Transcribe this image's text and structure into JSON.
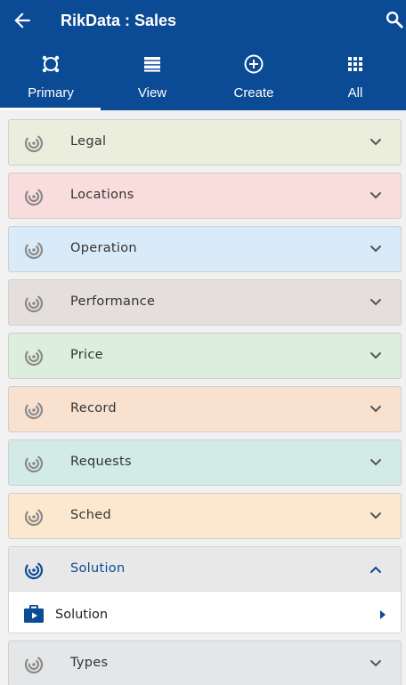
{
  "header": {
    "title": "RikData : Sales",
    "back_icon": "arrow-left-icon",
    "search_icon": "search-icon"
  },
  "tabs": [
    {
      "label": "Primary",
      "icon": "focus-frame-icon",
      "active": true
    },
    {
      "label": "View",
      "icon": "list-view-icon",
      "active": false
    },
    {
      "label": "Create",
      "icon": "add-circle-icon",
      "active": false
    },
    {
      "label": "All",
      "icon": "grid-apps-icon",
      "active": false
    }
  ],
  "sections": [
    {
      "label": "Legal",
      "color": "#ebeedc",
      "expanded": false
    },
    {
      "label": "Locations",
      "color": "#f9dcdc",
      "expanded": false
    },
    {
      "label": "Operation",
      "color": "#d9eaf8",
      "expanded": false
    },
    {
      "label": "Performance",
      "color": "#e4dfdc",
      "expanded": false
    },
    {
      "label": "Price",
      "color": "#ddefdc",
      "expanded": false
    },
    {
      "label": "Record",
      "color": "#f9e1d0",
      "expanded": false
    },
    {
      "label": "Requests",
      "color": "#d3ebe6",
      "expanded": false
    },
    {
      "label": "Sched",
      "color": "#fbe8cf",
      "expanded": false
    },
    {
      "label": "Solution",
      "color": "#e8e8e8",
      "expanded": true,
      "children": [
        {
          "label": "Solution",
          "icon": "video-briefcase-icon"
        }
      ]
    },
    {
      "label": "Types",
      "color": "#e4e6e8",
      "expanded": false
    }
  ],
  "colors": {
    "brand": "#0b4a94",
    "section_icon": "#8a8a8a",
    "active_text": "#0b4a94"
  }
}
